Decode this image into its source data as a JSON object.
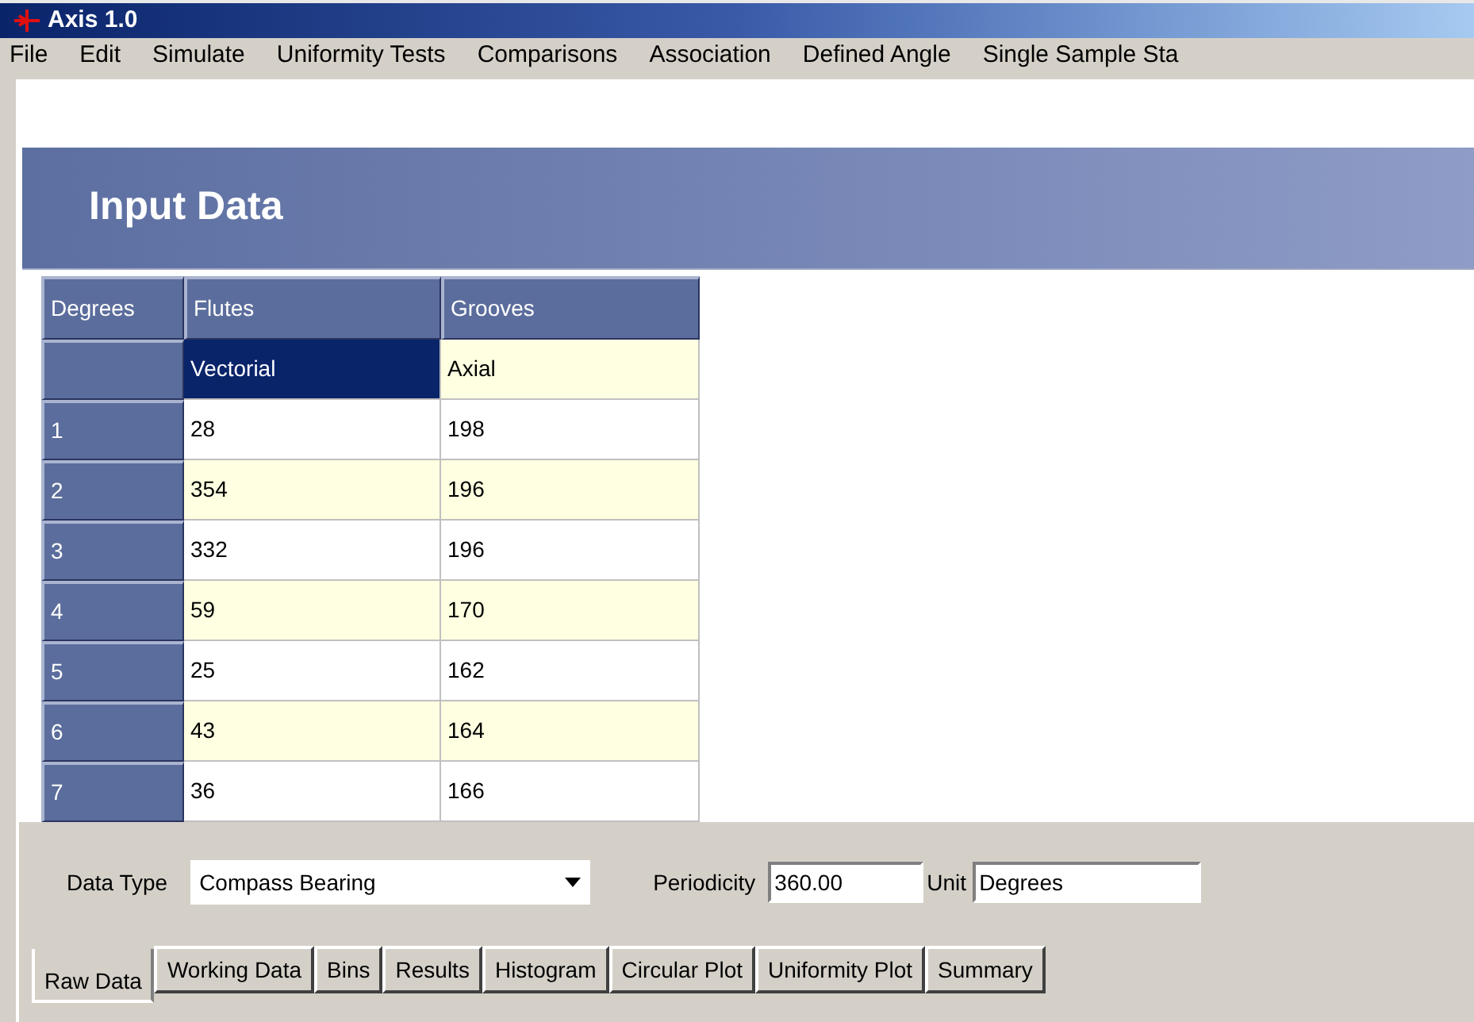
{
  "window": {
    "title": "Axis 1.0"
  },
  "menu": [
    {
      "label": "File"
    },
    {
      "label": "Edit"
    },
    {
      "label": "Simulate"
    },
    {
      "label": "Uniformity Tests"
    },
    {
      "label": "Comparisons"
    },
    {
      "label": "Association"
    },
    {
      "label": "Defined Angle"
    },
    {
      "label": "Single Sample Sta"
    }
  ],
  "banner": {
    "title": "Input Data"
  },
  "table": {
    "columns": [
      "Degrees",
      "Flutes",
      "Grooves"
    ],
    "rows": [
      {
        "kind": "type",
        "cells": [
          {
            "text": "",
            "selected": false
          },
          {
            "text": "Vectorial",
            "selected": true
          },
          {
            "text": "Axial",
            "selected": false
          }
        ]
      },
      {
        "kind": "data",
        "cells": [
          "1",
          "28",
          "198"
        ]
      },
      {
        "kind": "data",
        "cells": [
          "2",
          "354",
          "196"
        ]
      },
      {
        "kind": "data",
        "cells": [
          "3",
          "332",
          "196"
        ]
      },
      {
        "kind": "data",
        "cells": [
          "4",
          "59",
          "170"
        ]
      },
      {
        "kind": "data",
        "cells": [
          "5",
          "25",
          "162"
        ]
      },
      {
        "kind": "data",
        "cells": [
          "6",
          "43",
          "164"
        ]
      },
      {
        "kind": "data",
        "cells": [
          "7",
          "36",
          "166"
        ]
      }
    ]
  },
  "data_type": {
    "label": "Data Type",
    "value": "Compass Bearing"
  },
  "periodicity": {
    "label": "Periodicity",
    "value": "360.00"
  },
  "unit": {
    "label": "Unit",
    "value": "Degrees"
  },
  "tabs": [
    {
      "label": "Raw Data",
      "selected": true
    },
    {
      "label": "Working Data",
      "selected": false
    },
    {
      "label": "Bins",
      "selected": false
    },
    {
      "label": "Results",
      "selected": false
    },
    {
      "label": "Histogram",
      "selected": false
    },
    {
      "label": "Circular Plot",
      "selected": false
    },
    {
      "label": "Uniformity Plot",
      "selected": false
    },
    {
      "label": "Summary",
      "selected": false
    }
  ]
}
